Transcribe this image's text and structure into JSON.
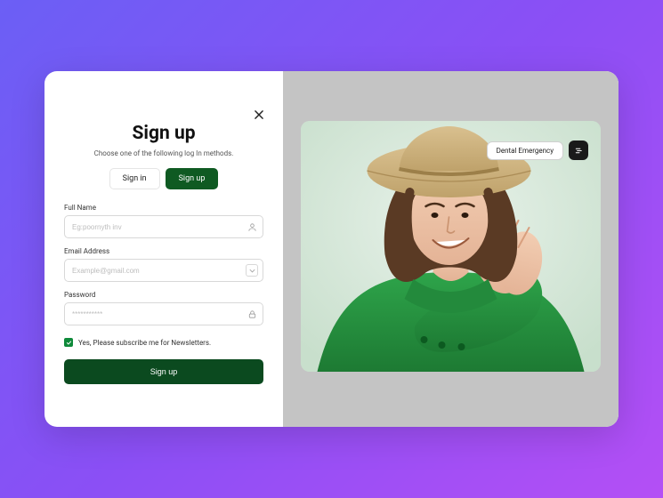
{
  "form": {
    "title": "Sign up",
    "subtitle": "Choose one of the following log In methods.",
    "tabs": {
      "signin": "Sign in",
      "signup": "Sign up"
    },
    "fields": {
      "fullname": {
        "label": "Full Name",
        "placeholder": "Eg:poornyth inv"
      },
      "email": {
        "label": "Email Address",
        "placeholder": "Example@gmail.com"
      },
      "password": {
        "label": "Password",
        "placeholder": "***********"
      }
    },
    "newsletter_label": "Yes, Please subscribe me for Newsletters.",
    "submit_label": "Sign up"
  },
  "hero": {
    "badge_label": "Dental Emergency"
  },
  "colors": {
    "brand_green": "#0f5a22",
    "accent_green": "#0f8a3a"
  }
}
